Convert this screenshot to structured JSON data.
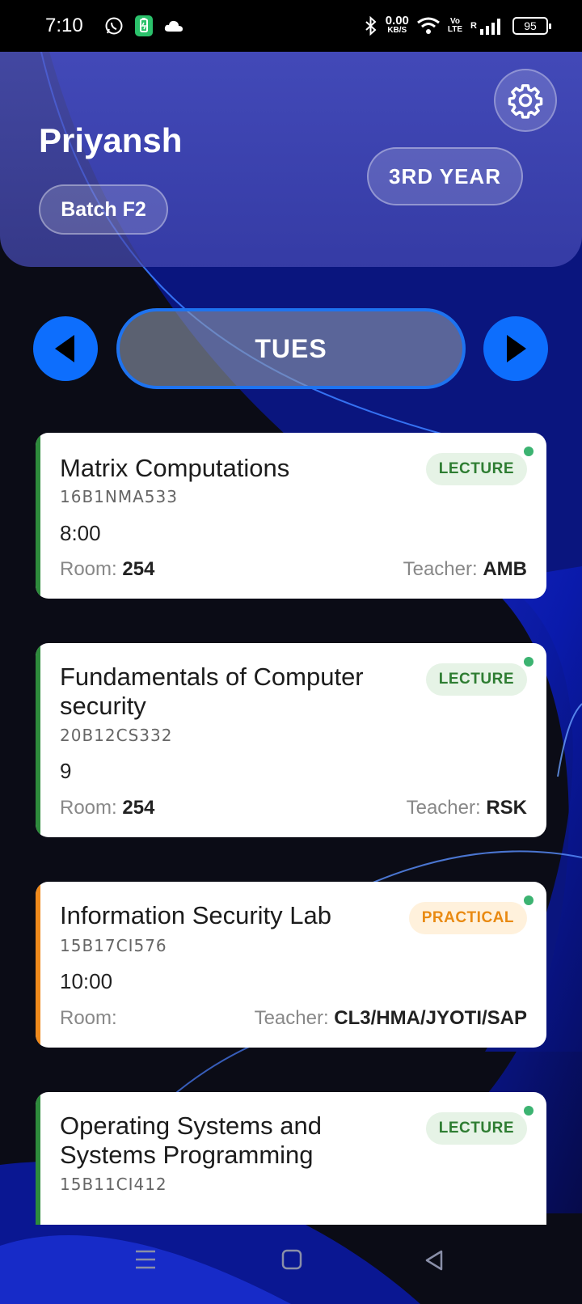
{
  "status_bar": {
    "time": "7:10",
    "net_speed_value": "0.00",
    "net_speed_unit": "KB/S",
    "volte_top": "Vo",
    "volte_bottom": "LTE",
    "roaming": "R",
    "battery_level": "95"
  },
  "header": {
    "name": "Priyansh",
    "batch": "Batch F2",
    "year": "3RD YEAR"
  },
  "day_switcher": {
    "day": "TUES"
  },
  "classes": [
    {
      "title": "Matrix Computations",
      "code": "16B1NMA533",
      "time": "8:00",
      "room_label": "Room:",
      "room": "254",
      "teacher_label": "Teacher:",
      "teacher": "AMB",
      "type": "LECTURE",
      "accent": "#2e8b3c"
    },
    {
      "title": "Fundamentals of Computer security",
      "code": "20B12CS332",
      "time": "9",
      "room_label": "Room:",
      "room": "254",
      "teacher_label": "Teacher:",
      "teacher": "RSK",
      "type": "LECTURE",
      "accent": "#2e8b3c"
    },
    {
      "title": "Information Security Lab",
      "code": "15B17CI576",
      "time": "10:00",
      "room_label": "Room:",
      "room": "",
      "teacher_label": "Teacher:",
      "teacher": "CL3/HMA/JYOTI/SAP",
      "type": "PRACTICAL",
      "accent": "#f08a1c"
    },
    {
      "title": "Operating Systems and Systems Programming",
      "code": "15B11CI412",
      "type": "LECTURE",
      "accent": "#2e8b3c"
    }
  ],
  "icons": {
    "settings": "gear-icon",
    "prev": "triangle-left-icon",
    "next": "triangle-right-icon",
    "nav_menu": "menu-icon",
    "nav_home": "square-icon",
    "nav_back": "back-triangle-icon"
  },
  "colors": {
    "accent_blue": "#0d6efd",
    "lecture_green": "#2e7d32",
    "practical_orange": "#e98a12"
  }
}
